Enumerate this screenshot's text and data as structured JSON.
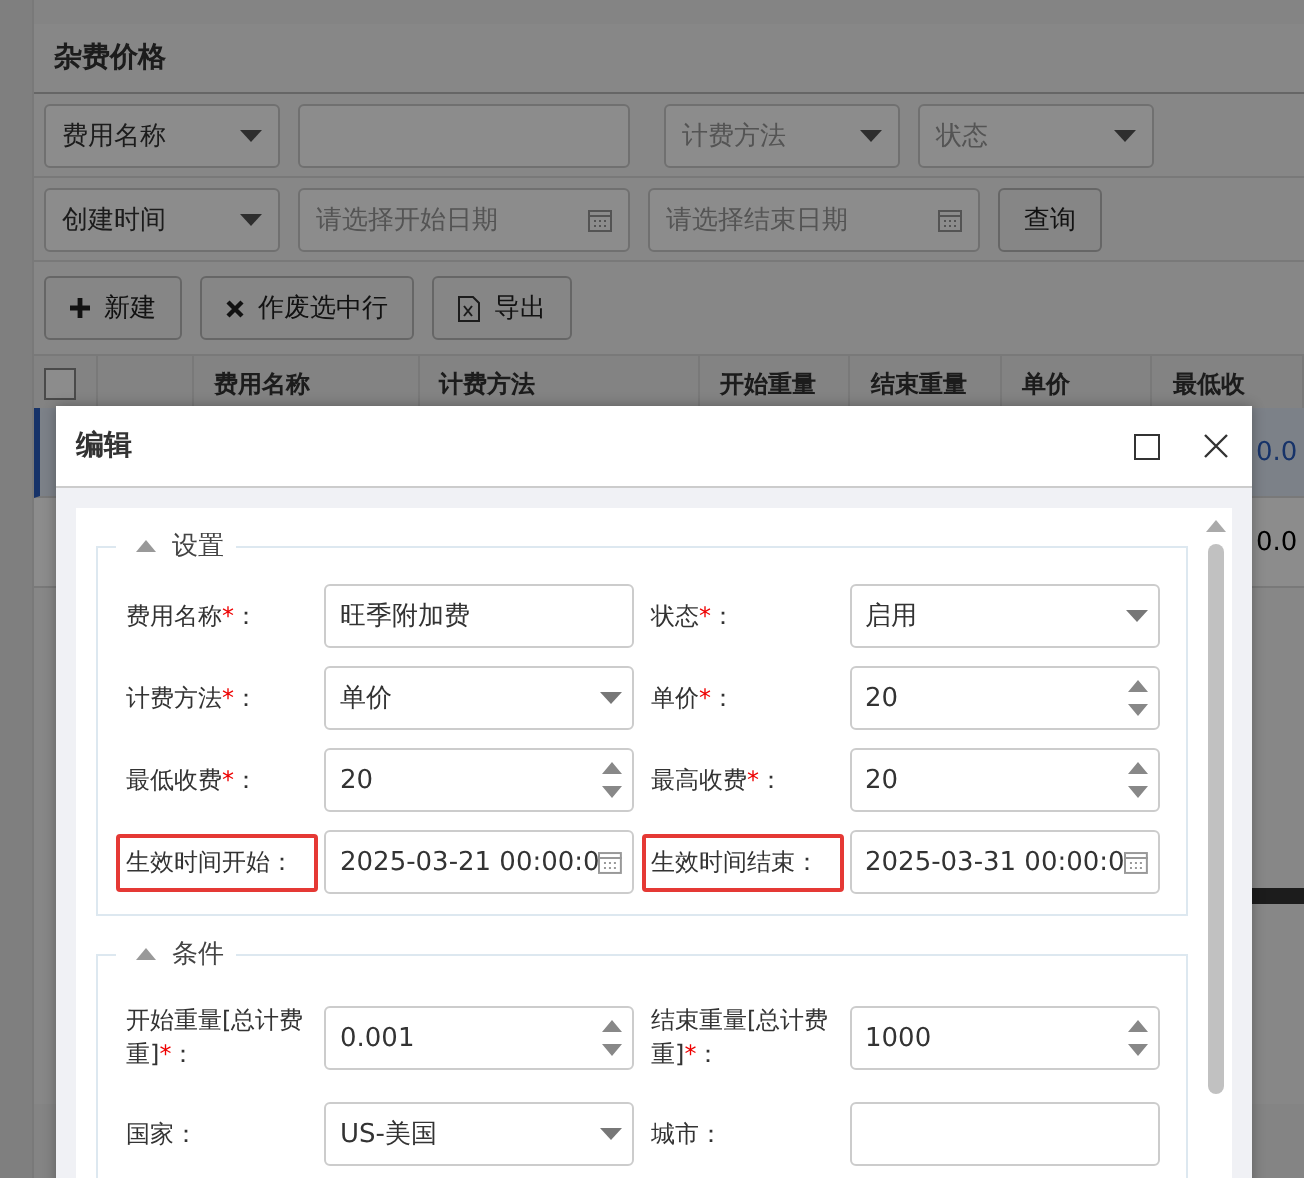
{
  "page": {
    "title": "杂费价格"
  },
  "filters": [
    {
      "kind": "select",
      "value": "费用名称"
    },
    {
      "kind": "text"
    },
    {
      "kind": "select",
      "placeholder": "计费方法"
    },
    {
      "kind": "select",
      "placeholder": "状态"
    }
  ],
  "filters_row_2": [
    {
      "kind": "select",
      "value": "创建时间"
    },
    {
      "kind": "date",
      "placeholder": "请选择开始日期"
    },
    {
      "kind": "date",
      "placeholder": "请选择结束日期"
    }
  ],
  "search_button": "查询",
  "toolbar": [
    {
      "kind": "plus",
      "label": "新建"
    },
    {
      "kind": "cross",
      "label": "作废选中行"
    },
    {
      "kind": "export",
      "label": "导出"
    }
  ],
  "table": {
    "header_checkbox": {
      "checked": false
    },
    "columns": [
      "",
      "费用名称",
      "计费方法",
      "开始重量",
      "结束重量",
      "单价",
      "最低收"
    ],
    "rows": [
      {
        "selected": true,
        "column_7": "0.0"
      },
      {
        "selected": false,
        "column_7": "0.0"
      }
    ]
  },
  "dialog": {
    "title": "编辑",
    "sections": [
      {
        "title": "设置",
        "expanded": true,
        "fields": [
          {
            "label": "费用名称",
            "required_mark": "*",
            "label_suffix": "：",
            "kind": "text",
            "value": "旺季附加费",
            "highlighted": false
          },
          {
            "label": "状态",
            "required_mark": "*",
            "label_suffix": "：",
            "kind": "select",
            "value": "启用",
            "highlighted": false
          },
          {
            "label": "计费方法",
            "required_mark": "*",
            "label_suffix": "：",
            "kind": "select",
            "value": "单价",
            "highlighted": false
          },
          {
            "label": "单价",
            "required_mark": "*",
            "label_suffix": "：",
            "kind": "number",
            "value": "20",
            "highlighted": false
          },
          {
            "label": "最低收费",
            "required_mark": "*",
            "label_suffix": "：",
            "kind": "number",
            "value": "20",
            "highlighted": false
          },
          {
            "label": "最高收费",
            "required_mark": "*",
            "label_suffix": "：",
            "kind": "number",
            "value": "20",
            "highlighted": false
          },
          {
            "label": "生效时间开始：",
            "kind": "date",
            "value": "2025-03-21 00:00:0",
            "highlighted": true
          },
          {
            "label": "生效时间结束：",
            "kind": "date",
            "value": "2025-03-31 00:00:0",
            "highlighted": true
          }
        ]
      },
      {
        "title": "条件",
        "expanded": true,
        "fields": [
          {
            "label": "开始重量[总计费重]",
            "required_mark": "*",
            "label_suffix": "：",
            "kind": "number",
            "value": "0.001",
            "highlighted": false
          },
          {
            "label": "结束重量[总计费重]",
            "required_mark": "*",
            "label_suffix": "：",
            "kind": "number",
            "value": "1000",
            "highlighted": false
          },
          {
            "label": "国家：",
            "kind": "select",
            "value": "US-美国",
            "highlighted": false
          },
          {
            "label": "城市：",
            "kind": "text",
            "highlighted": false
          }
        ]
      }
    ]
  }
}
